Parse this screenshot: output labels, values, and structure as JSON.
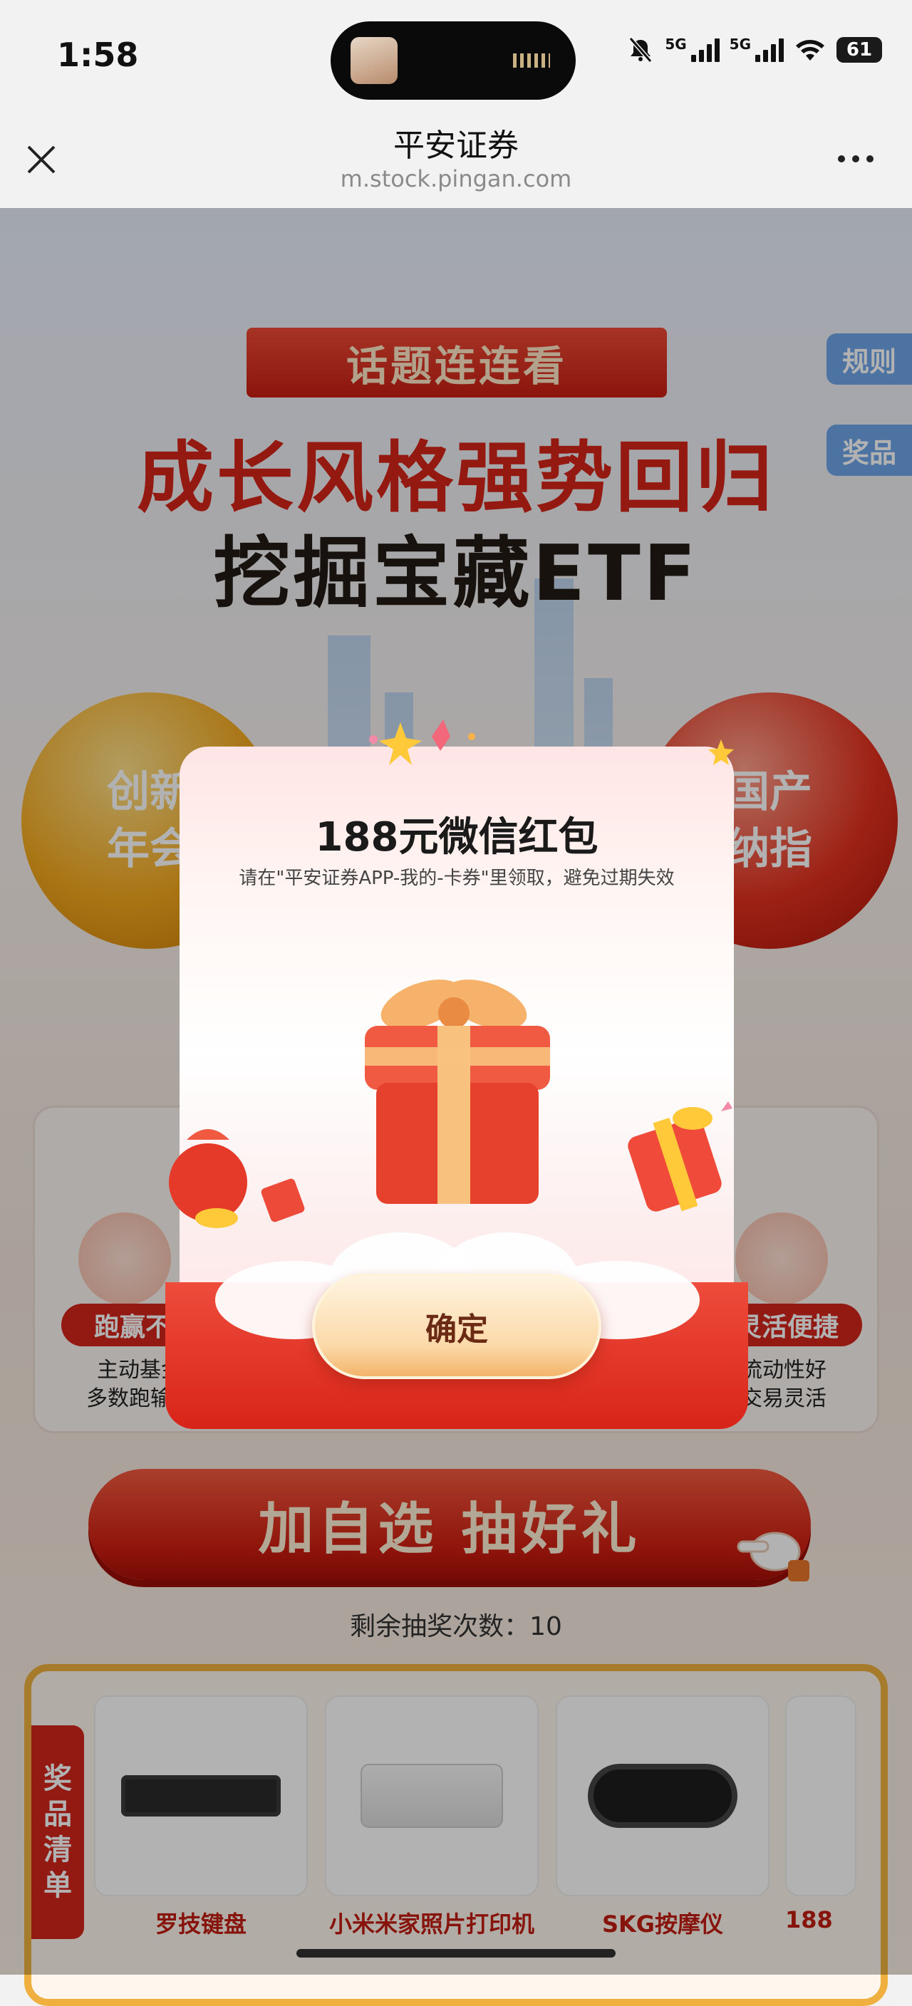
{
  "status_bar": {
    "time": "1:58",
    "network_1": "5G",
    "network_2": "5G",
    "battery": "61"
  },
  "nav": {
    "title": "平安证券",
    "url": "m.stock.pingan.com"
  },
  "page": {
    "topic_badge": "话题连连看",
    "side_tabs": [
      "规则",
      "奖品"
    ],
    "headline_1": "成长风格强势回归",
    "headline_2": "挖掘宝藏ETF",
    "orb_left": [
      "创新",
      "年会"
    ],
    "orb_right": [
      "国产",
      "纳指"
    ],
    "features": [
      {
        "badge": "跑赢不",
        "desc_1": "主动基金",
        "desc_2": "多数跑输指"
      },
      {
        "badge": "灵活便捷",
        "desc_1": "流动性好",
        "desc_2": "交易灵活"
      }
    ],
    "cta_label": "加自选  抽好礼",
    "remaining_label": "剩余抽奖次数：10",
    "prize_ribbon": [
      "奖",
      "品",
      "清",
      "单"
    ],
    "prizes": [
      "罗技键盘",
      "小米米家照片打印机",
      "SKG按摩仪",
      "188"
    ]
  },
  "modal": {
    "title": "188元微信红包",
    "subtitle": "请在\"平安证券APP-我的-卡券\"里领取，避免过期失效",
    "confirm_label": "确定"
  },
  "colors": {
    "accent_red": "#d2261b",
    "tab_blue": "#6fa5ea",
    "gold_border": "#f0b040"
  }
}
